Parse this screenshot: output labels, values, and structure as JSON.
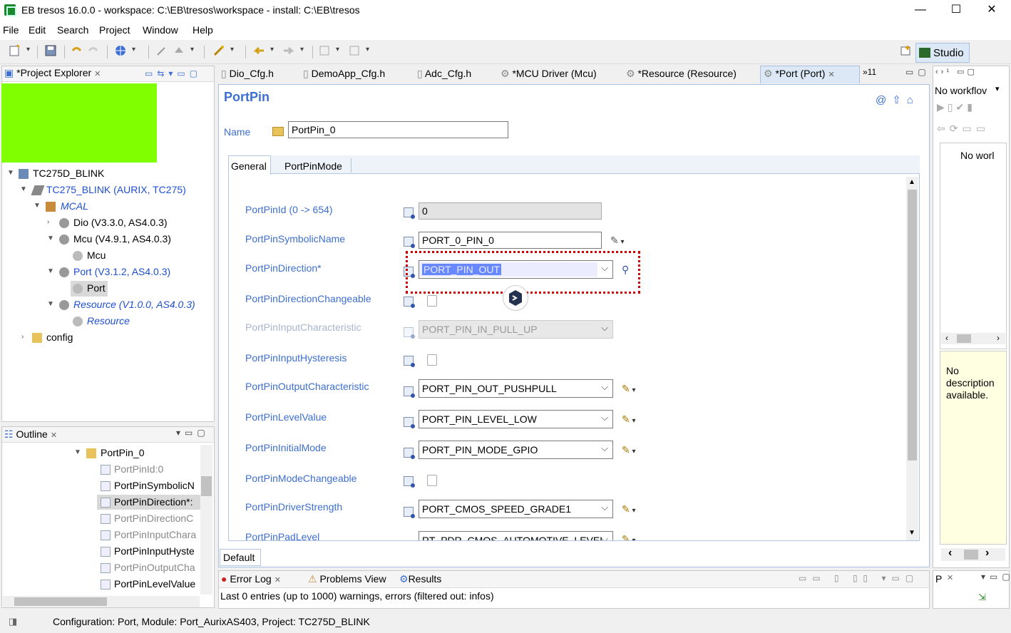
{
  "window": {
    "title": "EB tresos 16.0.0 - workspace: C:\\EB\\tresos\\workspace - install: C:\\EB\\tresos",
    "minimize": "—",
    "maximize": "☐",
    "close": "✕"
  },
  "menu": [
    "File",
    "Edit",
    "Search",
    "Project",
    "Window",
    "Help"
  ],
  "perspective": {
    "label": "Studio"
  },
  "project_explorer": {
    "tab_label": "*Project Explorer",
    "tree": [
      {
        "label": "TC275D_BLINK"
      },
      {
        "label": "TC275_BLINK (AURIX, TC275)"
      },
      {
        "label": "MCAL"
      },
      {
        "label": "Dio (V3.3.0, AS4.0.3)"
      },
      {
        "label": "Mcu (V4.9.1, AS4.0.3)"
      },
      {
        "label": "Mcu"
      },
      {
        "label": "Port (V3.1.2, AS4.0.3)"
      },
      {
        "label": "Port"
      },
      {
        "label": "Resource (V1.0.0, AS4.0.3)"
      },
      {
        "label": "Resource"
      },
      {
        "label": "config"
      }
    ]
  },
  "outline": {
    "tab_label": "Outline",
    "items": [
      {
        "label": "PortPin_0"
      },
      {
        "label": "PortPinId:0"
      },
      {
        "label": "PortPinSymbolicN"
      },
      {
        "label": "PortPinDirection*:"
      },
      {
        "label": "PortPinDirectionC"
      },
      {
        "label": "PortPinInputChara"
      },
      {
        "label": "PortPinInputHyste"
      },
      {
        "label": "PortPinOutputCha"
      },
      {
        "label": "PortPinLevelValue"
      }
    ]
  },
  "editor_tabs": [
    {
      "label": "Dio_Cfg.h"
    },
    {
      "label": "DemoApp_Cfg.h"
    },
    {
      "label": "Adc_Cfg.h"
    },
    {
      "label": "*MCU Driver (Mcu)"
    },
    {
      "label": "*Resource (Resource)"
    },
    {
      "label": "*Port (Port)"
    }
  ],
  "editor_overflow": "»11",
  "editor": {
    "title": "PortPin",
    "name_label": "Name",
    "name_value": "PortPin_0",
    "subtabs": [
      "General",
      "PortPinMode"
    ],
    "bottom_tab": "Default",
    "fields": [
      {
        "label": "PortPinId (0 -> 654)",
        "value": "0"
      },
      {
        "label": "PortPinSymbolicName",
        "value": "PORT_0_PIN_0"
      },
      {
        "label": "PortPinDirection*",
        "value": "PORT_PIN_OUT"
      },
      {
        "label": "PortPinDirectionChangeable",
        "value": ""
      },
      {
        "label": "PortPinInputCharacteristic",
        "value": "PORT_PIN_IN_PULL_UP"
      },
      {
        "label": "PortPinInputHysteresis",
        "value": ""
      },
      {
        "label": "PortPinOutputCharacteristic",
        "value": "PORT_PIN_OUT_PUSHPULL"
      },
      {
        "label": "PortPinLevelValue",
        "value": "PORT_PIN_LEVEL_LOW"
      },
      {
        "label": "PortPinInitialMode",
        "value": "PORT_PIN_MODE_GPIO"
      },
      {
        "label": "PortPinModeChangeable",
        "value": ""
      },
      {
        "label": "PortPinDriverStrength",
        "value": "PORT_CMOS_SPEED_GRADE1"
      },
      {
        "label": "PortPinPadLevel",
        "value": "RT_PDR_CMOS_AUTOMOTIVE_LEVEL"
      }
    ]
  },
  "workflow": {
    "tab_label": "No workflov",
    "empty_text": "No worl",
    "description": "No description available."
  },
  "bottom_panel": {
    "tabs": [
      "Error Log",
      "Problems View",
      "Results"
    ],
    "status_text": "Last 0 entries (up to 1000) warnings, errors (filtered out: infos)"
  },
  "properties_tab": {
    "label": "P"
  },
  "statusbar": {
    "text": "Configuration: Port, Module: Port_AurixAS403, Project: TC275D_BLINK"
  },
  "colors": {
    "accent_blue": "#1f4fd1",
    "highlight_green": "#80ff00",
    "selection_blue": "#3366ff",
    "red_dashed": "#cc0000"
  }
}
